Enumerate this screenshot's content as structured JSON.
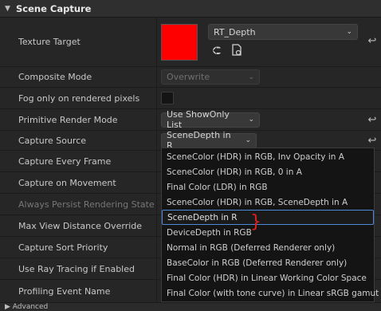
{
  "section": {
    "title": "Scene Capture"
  },
  "rows": [
    {
      "label": "Texture Target"
    },
    {
      "label": "Composite Mode",
      "value": "Overwrite"
    },
    {
      "label": "Fog only on rendered pixels"
    },
    {
      "label": "Primitive Render Mode",
      "value": "Use ShowOnly List"
    },
    {
      "label": "Capture Source",
      "value": "SceneDepth in R"
    },
    {
      "label": "Capture Every Frame"
    },
    {
      "label": "Capture on Movement"
    },
    {
      "label": "Always Persist Rendering State"
    },
    {
      "label": "Max View Distance Override"
    },
    {
      "label": "Capture Sort Priority"
    },
    {
      "label": "Use Ray Tracing if Enabled"
    },
    {
      "label": "Profiling Event Name"
    }
  ],
  "texture_target": {
    "asset_name": "RT_Depth",
    "swatch_color": "#ff0000"
  },
  "capture_source_menu": {
    "options": [
      "SceneColor (HDR) in RGB, Inv Opacity in A",
      "SceneColor (HDR) in RGB, 0 in A",
      "Final Color (LDR) in RGB",
      "SceneColor (HDR) in RGB, SceneDepth in A",
      "SceneDepth in R",
      "DeviceDepth in RGB",
      "Normal in RGB (Deferred Renderer only)",
      "BaseColor in RGB (Deferred Renderer only)",
      "Final Color (HDR) in Linear Working Color Space",
      "Final Color (with tone curve) in Linear sRGB gamut"
    ],
    "selected": "SceneDepth in R"
  },
  "footer": {
    "label": "Advanced"
  },
  "icons": {
    "collapse": "chevron-down-icon",
    "reset": "reset-arrow-icon",
    "browse": "browse-back-icon",
    "asset": "asset-file-icon"
  },
  "colors": {
    "selection_border": "#4a8ad8",
    "annotation": "#e02020"
  }
}
